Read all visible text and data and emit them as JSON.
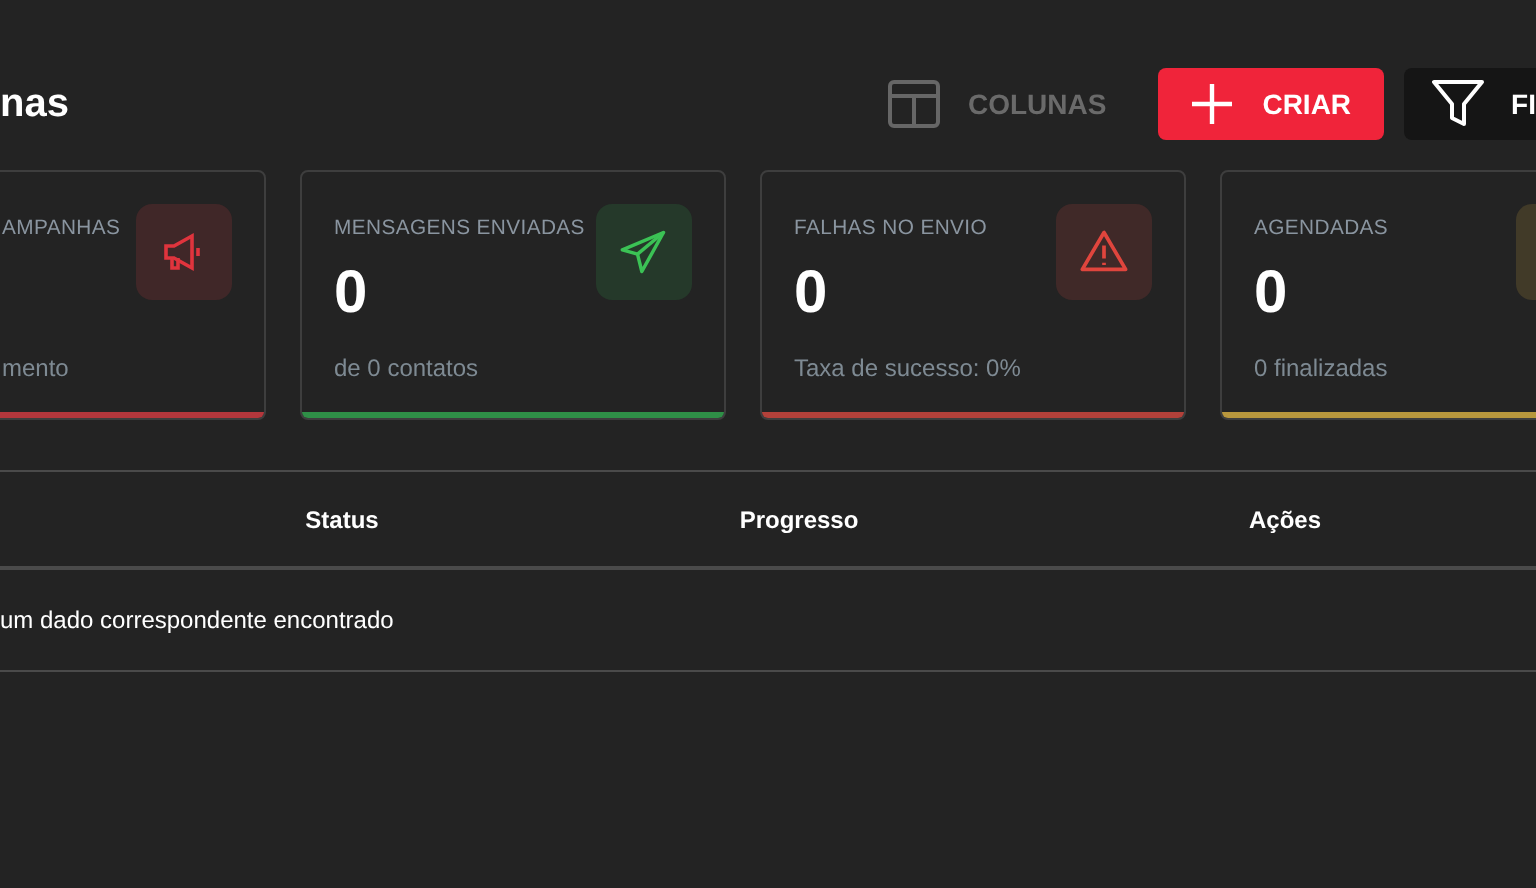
{
  "header": {
    "title": "nas",
    "buttons": [
      {
        "kind": "columns",
        "label": "COLUNAS"
      },
      {
        "kind": "create",
        "label": "CRIAR"
      },
      {
        "kind": "filter",
        "label": "FI"
      }
    ]
  },
  "stats": [
    {
      "kind": "campaigns",
      "label": "AMPANHAS",
      "caption": "mento",
      "color": "#b3373c"
    },
    {
      "kind": "sent",
      "label": "MENSAGENS ENVIADAS",
      "value": "0",
      "caption": "de 0 contatos",
      "color": "#2f8f47"
    },
    {
      "kind": "failed",
      "label": "FALHAS NO ENVIO",
      "value": "0",
      "caption": "Taxa de sucesso: 0%",
      "color": "#b2413a"
    },
    {
      "kind": "scheduled",
      "label": "AGENDADAS",
      "value": "0",
      "caption": "0 finalizadas",
      "color": "#b8973d"
    }
  ],
  "table": {
    "columns": [
      "Status",
      "Progresso",
      "Ações"
    ],
    "empty_message": "um dado correspondente encontrado"
  }
}
